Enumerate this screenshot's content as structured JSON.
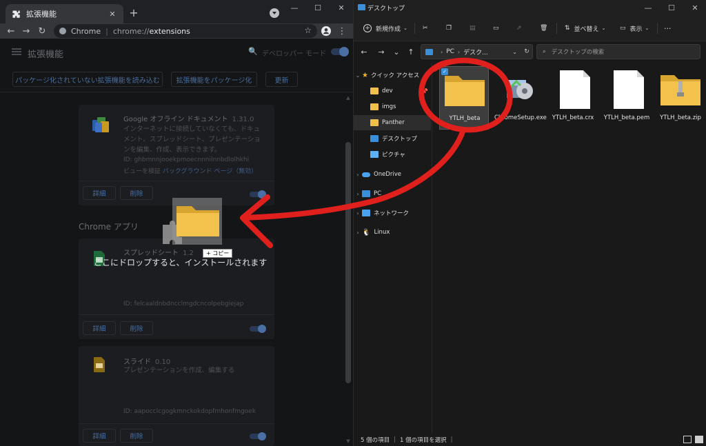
{
  "chrome": {
    "tab_title": "拡張機能",
    "tab_close": "✕",
    "new_tab": "+",
    "omnibox_site": "Chrome",
    "omnibox_sep": "|",
    "omnibox_scheme": "chrome://",
    "omnibox_host": "extensions",
    "star": "☆",
    "window_controls": [
      "—",
      "☐",
      "✕"
    ],
    "nav": {
      "back": "←",
      "forward": "→",
      "reload": "↻",
      "more": "⋮"
    }
  },
  "extensions_page": {
    "title": "拡張機能",
    "dev_mode_label": "デベロッパー モード",
    "dev_mode_on": true,
    "search_icon": "🔍",
    "actions": [
      "パッケージ化されていない拡張機能を読み込む",
      "拡張機能をパッケージ化",
      "更新"
    ],
    "cards": [
      {
        "name": "Google オフライン ドキュメント",
        "version": "1.31.0",
        "description": "インターネットに接続していなくても、ドキュメント、スプレッドシート、プレゼンテーションを編集、作成、表示できます。",
        "id": "ID: ghbmnnjooekpmoecnnnilnnbdlolhkhi",
        "view_label": "ビューを検証",
        "view_link": "バックグラウンド ページ（無効）",
        "details_button": "詳細",
        "remove_button": "削除",
        "enabled": true,
        "icon": "google-docs-offline-icon"
      },
      {
        "name": "スプレッドシート",
        "version": "1.2",
        "description": "",
        "id": "ID: felcaaldnbdncclmgdcncolpebgiejap",
        "details_button": "詳細",
        "remove_button": "削除",
        "enabled": true,
        "icon": "sheets-icon"
      },
      {
        "name": "スライド",
        "version": "0.10",
        "description": "プレゼンテーションを作成、編集する",
        "id": "ID: aapocclcgogkmnckokdopfmhonfmgoek",
        "details_button": "詳細",
        "remove_button": "削除",
        "enabled": true,
        "icon": "slides-icon"
      }
    ],
    "section_title": "Chrome アプリ",
    "drop_hint": "ここにドロップすると、インストールされます",
    "copy_badge": "+ コピー"
  },
  "explorer": {
    "title": "デスクトップ",
    "window_controls": [
      "—",
      "☐",
      "✕"
    ],
    "commands": {
      "new": "新規作成",
      "sort": "並べ替え",
      "view": "表示",
      "more": "···"
    },
    "address": [
      "PC",
      "デスク..."
    ],
    "search_placeholder": "デスクトップの検索",
    "nav": {
      "back": "←",
      "forward": "→",
      "recent": "⌄",
      "up": "↑",
      "refresh": "↻"
    },
    "sidebar": [
      {
        "label": "クイック アクセス",
        "icon": "star-icon"
      },
      {
        "label": "dev",
        "icon": "folder-icon"
      },
      {
        "label": "imgs",
        "icon": "folder-icon"
      },
      {
        "label": "Panther",
        "icon": "folder-icon"
      },
      {
        "label": "デスクトップ",
        "icon": "desktop-icon"
      },
      {
        "label": "ピクチャ",
        "icon": "pictures-icon"
      },
      {
        "label": "OneDrive",
        "icon": "cloud-icon"
      },
      {
        "label": "PC",
        "icon": "pc-icon"
      },
      {
        "label": "ネットワーク",
        "icon": "network-icon"
      },
      {
        "label": "Linux",
        "icon": "linux-icon"
      }
    ],
    "files": [
      {
        "name": "YTLH_beta",
        "type": "folder",
        "selected": true
      },
      {
        "name": "ChromeSetup.exe",
        "type": "exe"
      },
      {
        "name": "YTLH_beta.crx",
        "type": "doc"
      },
      {
        "name": "YTLH_beta.pem",
        "type": "doc"
      },
      {
        "name": "YTLH_beta.zip",
        "type": "zip"
      }
    ],
    "status": {
      "count": "5 個の項目",
      "selected": "1 個の項目を選択"
    }
  },
  "colors": {
    "annotation": "#e0201c",
    "accent": "#3a8fd8",
    "folder": "#f0c04a"
  }
}
